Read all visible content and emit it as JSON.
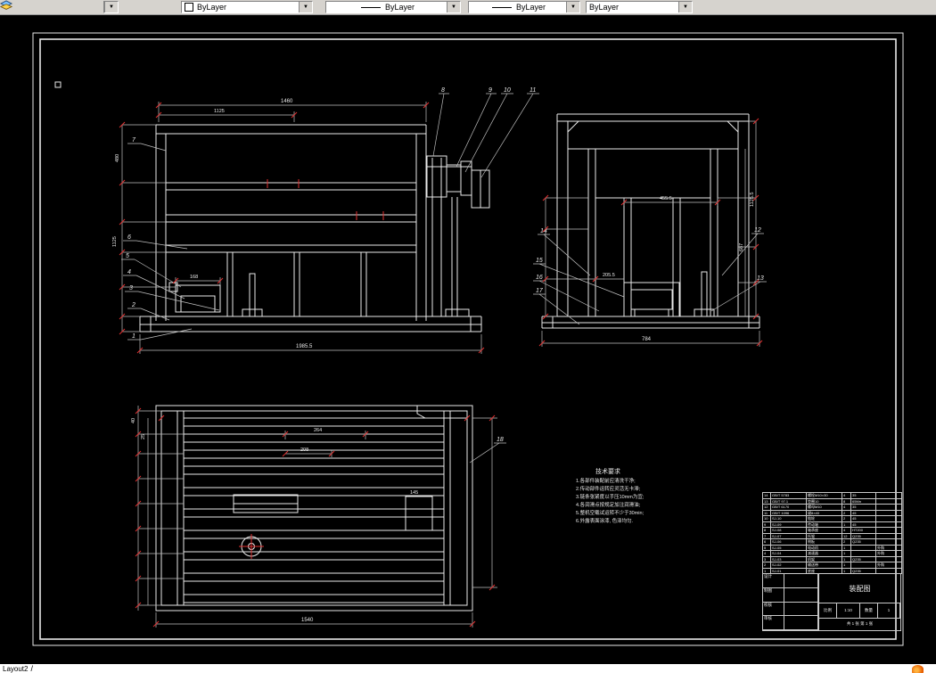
{
  "toolbar": {
    "color_combo": "ByLayer",
    "linetype_combo": "ByLayer",
    "lineweight_combo": "ByLayer",
    "plotstyle_combo": "ByLayer"
  },
  "statusbar": {
    "layout_tab": "Layout2"
  },
  "drawing": {
    "callouts": {
      "side_left": [
        "7",
        "6",
        "5",
        "4",
        "3",
        "2",
        "1"
      ],
      "side_top": [
        "8",
        "9",
        "10",
        "11"
      ],
      "end_right": [
        "12",
        "13"
      ],
      "end_left": [
        "14",
        "15",
        "16",
        "17"
      ],
      "plan": [
        "18"
      ]
    },
    "dims": {
      "side_top": "1460",
      "side_top2": "1125",
      "side_bottom": "1985.5",
      "side_left_a": "480",
      "side_left_b": "1125",
      "side_feeder": "168",
      "end_bottom": "784",
      "end_width": "455.5",
      "end_h1": "687",
      "end_h2": "1125.5",
      "end_inner": "205.5",
      "plan_bottom": "1540",
      "plan_w1": "264",
      "plan_w2": "208",
      "plan_w3": "145",
      "plan_left_a": "40",
      "plan_left_b": "25"
    },
    "notes": {
      "title": "技术要求",
      "lines": [
        "1.各部件装配前应清洗干净;",
        "2.传动部件运转应灵活无卡滞;",
        "3.链条张紧度以手压10mm为宜;",
        "4.各润滑点按规定加注润滑油;",
        "5.整机空载试运转不少于30min;",
        "6.外露表面涂漆, 色泽均匀."
      ]
    }
  },
  "titleblock": {
    "bom": [
      [
        "14",
        "GB/T 5783",
        "螺栓M10×30",
        "4",
        "35",
        ""
      ],
      [
        "13",
        "GB/T 97.1",
        "垫圈10",
        "8",
        "65Mn",
        ""
      ],
      [
        "12",
        "GB/T 6170",
        "螺母M10",
        "4",
        "35",
        ""
      ],
      [
        "11",
        "GB/T 1096",
        "键8×40",
        "2",
        "45",
        ""
      ],
      [
        "10",
        "SJ-10",
        "链轮",
        "2",
        "45",
        ""
      ],
      [
        "9",
        "SJ-09",
        "传动轴",
        "1",
        "45",
        ""
      ],
      [
        "8",
        "SJ-08",
        "轴承座",
        "4",
        "HT200",
        ""
      ],
      [
        "7",
        "SJ-07",
        "托辊",
        "12",
        "Q235",
        ""
      ],
      [
        "6",
        "SJ-06",
        "侧板",
        "2",
        "Q235",
        ""
      ],
      [
        "5",
        "SJ-05",
        "电动机",
        "1",
        "",
        "外购"
      ],
      [
        "4",
        "SJ-04",
        "减速器",
        "1",
        "",
        "外购"
      ],
      [
        "3",
        "SJ-03",
        "机架",
        "1",
        "Q235",
        ""
      ],
      [
        "2",
        "SJ-02",
        "输送带",
        "1",
        "",
        "外购"
      ],
      [
        "1",
        "SJ-01",
        "底座",
        "1",
        "Q235",
        ""
      ]
    ],
    "fields": {
      "design": "设计",
      "draw": "制图",
      "check": "校核",
      "approve": "审核",
      "name": "装配图",
      "scale_label": "比例",
      "scale": "1:10",
      "qty_label": "数量",
      "qty": "1",
      "sheet": "共 1 张  第 1 张"
    }
  }
}
